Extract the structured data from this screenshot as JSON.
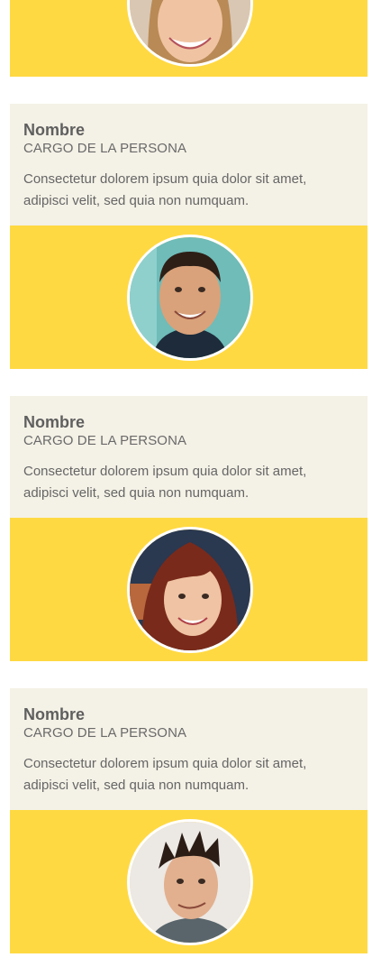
{
  "team": {
    "cards": [
      {
        "name": "Nombre",
        "role": "CARGO DE LA PERSONA",
        "description": "Consectetur dolorem ipsum quia dolor sit amet, adipisci velit, sed quia non numquam.",
        "avatar_icon": "person-photo-man-smiling"
      },
      {
        "name": "Nombre",
        "role": "CARGO DE LA PERSONA",
        "description": "Consectetur dolorem ipsum quia dolor sit amet, adipisci velit, sed quia non numquam.",
        "avatar_icon": "person-photo-woman-red-hair"
      },
      {
        "name": "Nombre",
        "role": "CARGO DE LA PERSONA",
        "description": "Consectetur dolorem ipsum quia dolor sit amet, adipisci velit, sed quia non numquam.",
        "avatar_icon": "person-photo-man-spiky-hair"
      }
    ],
    "partial_top_avatar_icon": "person-photo-woman-blonde"
  },
  "colors": {
    "accent_yellow": "#FFD942",
    "info_background": "#F4F1E6",
    "text_gray": "#666666"
  }
}
